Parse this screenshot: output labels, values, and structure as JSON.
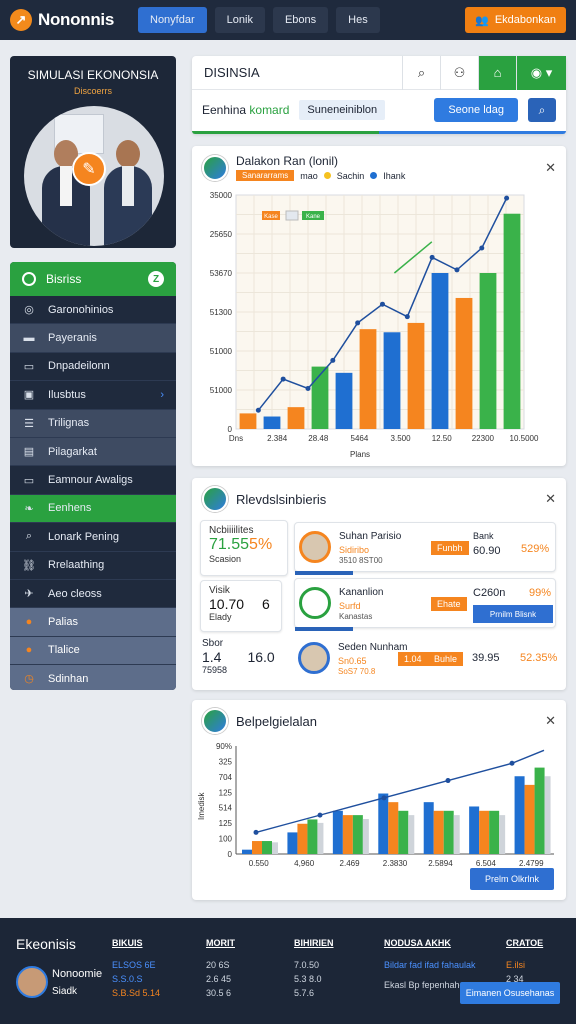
{
  "app": {
    "name": "Nononnis",
    "cta_label": "Ekdabonkan"
  },
  "topnav": [
    "Nonyfdar",
    "Lonik",
    "Ebons",
    "Hes"
  ],
  "hero": {
    "title": "SIMULASI EKONONSIA",
    "subtitle": "Discoerrs"
  },
  "sidebar": {
    "header": "Bisriss",
    "items": [
      {
        "label": "Garonohinios",
        "icon": "coin-icon"
      },
      {
        "label": "Payeranis",
        "icon": "card-icon"
      },
      {
        "label": "Dnpadeilonn",
        "icon": "window-icon"
      },
      {
        "label": "Ilusbtus",
        "icon": "doc-icon"
      },
      {
        "label": "Trilignas",
        "icon": "list-icon"
      },
      {
        "label": "Pilagarkat",
        "icon": "chart-icon"
      },
      {
        "label": "Eamnour Awaligs",
        "icon": "laptop-icon"
      },
      {
        "label": "Eenhens",
        "icon": "leaf-icon"
      },
      {
        "label": "Lonark Pening",
        "icon": "search-icon"
      },
      {
        "label": "Rrelaathing",
        "icon": "link-icon"
      },
      {
        "label": "Aeo cleoss",
        "icon": "plane-icon"
      },
      {
        "label": "Palias",
        "icon": "dot-icon"
      },
      {
        "label": "Tlalice",
        "icon": "dot-icon"
      },
      {
        "label": "Sdinhan",
        "icon": "clock-icon"
      }
    ]
  },
  "toolbar": {
    "title": "DISINSIA",
    "label_a": "Eenhina",
    "label_b": "komard",
    "chip": "Suneneiniblon",
    "primary_btn": "Seone ldag"
  },
  "chart_card": {
    "title": "Dalakon Ran (lonil)",
    "legend": [
      "Sanararrams",
      "mao",
      "Sachin",
      "Ihank"
    ],
    "legend_inner": [
      "Kase",
      "Kane"
    ]
  },
  "chart_data": [
    {
      "type": "bar",
      "title": "Dalakon Ran (lonil)",
      "categories": [
        "Dns",
        "2.384",
        "28.48",
        "5464",
        "3.500",
        "12.50",
        "22300",
        "10.5000"
      ],
      "ytick_labels": [
        "0",
        "51000",
        "51000",
        "51300",
        "53670",
        "25650",
        "35000"
      ],
      "series": [
        {
          "values": [
            8,
            8,
            10,
            16,
            18,
            24,
            28,
            42,
            45
          ],
          "color": "#f5851f"
        },
        {
          "values": [
            null,
            6,
            null,
            12,
            null,
            22,
            null,
            30,
            null
          ],
          "color": "#1f6fd1"
        },
        {
          "values": [
            null,
            null,
            null,
            14,
            null,
            null,
            null,
            26,
            36
          ],
          "color": "#3ab24a"
        }
      ],
      "bars": [
        {
          "c": "#f5851f",
          "v": 5
        },
        {
          "c": "#1f6fd1",
          "v": 4
        },
        {
          "c": "#f5851f",
          "v": 7
        },
        {
          "c": "#3ab24a",
          "v": 20
        },
        {
          "c": "#1f6fd1",
          "v": 18
        },
        {
          "c": "#f5851f",
          "v": 32
        },
        {
          "c": "#1f6fd1",
          "v": 31
        },
        {
          "c": "#f5851f",
          "v": 34
        },
        {
          "c": "#1f6fd1",
          "v": 50
        },
        {
          "c": "#f5851f",
          "v": 42
        },
        {
          "c": "#3ab24a",
          "v": 50
        },
        {
          "c": "#3ab24a",
          "v": 69
        }
      ],
      "line": [
        6,
        16,
        13,
        22,
        34,
        40,
        36,
        55,
        51,
        58,
        74
      ],
      "ylim": [
        0,
        75
      ],
      "xlabel": "Plans"
    },
    {
      "type": "bar",
      "title": "Belpelgielalan",
      "categories": [
        "0.550",
        "4,960",
        "2.469",
        "2.3830",
        "2.5894",
        "6.504",
        "2.4799"
      ],
      "ytick_labels": [
        "0",
        "100",
        "125",
        "514",
        "125",
        "704",
        "325",
        "90%"
      ],
      "ylabel": "Imedisk",
      "groups": [
        [
          2,
          6,
          6
        ],
        [
          10,
          14,
          16
        ],
        [
          20,
          18,
          18
        ],
        [
          28,
          24,
          20
        ],
        [
          24,
          20,
          20
        ],
        [
          22,
          20,
          20
        ],
        [
          36,
          32,
          40
        ]
      ],
      "line": [
        10,
        14,
        18,
        22,
        26,
        30,
        34,
        38,
        42,
        48
      ],
      "ylim": [
        0,
        50
      ]
    }
  ],
  "stats_card": {
    "title": "Rlevdslsinbieris",
    "mini": [
      {
        "k": "Ncbiiiilites",
        "v": "71.55",
        "pct": "5%",
        "sub": "Scasion"
      },
      {
        "k": "Visik",
        "v": "10.70",
        "v2": "6",
        "sub": "Elady"
      },
      {
        "k": "Sbor",
        "v": "1.4",
        "v2": "16.0",
        "sub": "75958"
      }
    ],
    "rows": [
      {
        "name": "Suhan Parisio",
        "sub": "Sidiribo",
        "sub2": "3510 8ST00",
        "tag": "Funbh",
        "val": "60.90",
        "col": "Bank",
        "pct": "529%"
      },
      {
        "name": "Kananlion",
        "sub": "Surfd",
        "sub2": "Kanastas",
        "tag": "Ehate",
        "val": "C260n",
        "pct": "99%",
        "btn": "Prnilm Blisnk"
      },
      {
        "name": "Seden Nunham",
        "sub": "Sn0.65",
        "sub2": "SoS7 70.8",
        "tag": "1.04",
        "tag2": "Buhle",
        "val": "39.95",
        "pct": "52.35%"
      }
    ]
  },
  "bottom_card": {
    "title": "Belpelgielalan",
    "btn": "Prelm Olkrlnk"
  },
  "footer": {
    "brand": "Ekeonisis",
    "person": "Nonoomie",
    "person_sub": "Siadk",
    "cols": [
      {
        "h": "BIKUIS",
        "items": [
          "ELSOS 6E",
          "S.S.0.S",
          "S.B.Sd 5.14"
        ]
      },
      {
        "h": "MORIT",
        "items": [
          "20 6S",
          "2.6 45",
          "30.5 6"
        ]
      },
      {
        "h": "BIHIRIEN",
        "items": [
          "7.0.50",
          "5.3 8.0",
          "5.7.6"
        ]
      },
      {
        "h": "NODUSA AKHK",
        "items": [
          "Bildar fad ifad fahaulak",
          "Ekasl Bp fepenhahe"
        ]
      },
      {
        "h": "CRATOE",
        "items": [
          "E.ilsi",
          "2 34"
        ]
      }
    ],
    "btn": "Eimanen Osusehanas"
  }
}
